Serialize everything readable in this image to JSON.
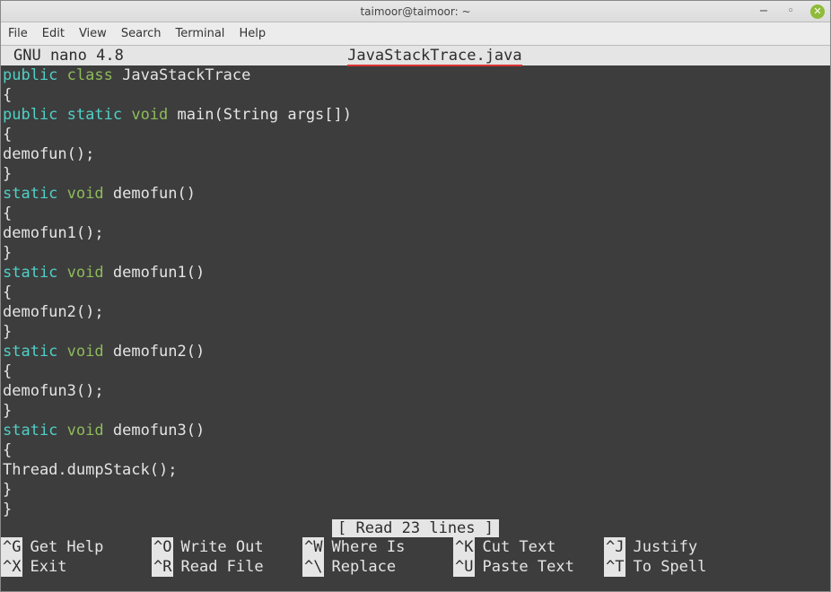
{
  "window": {
    "title": "taimoor@taimoor: ~"
  },
  "menu": {
    "items": [
      "File",
      "Edit",
      "View",
      "Search",
      "Terminal",
      "Help"
    ]
  },
  "nano": {
    "version": "GNU nano 4.8",
    "filename": "JavaStackTrace.java",
    "status": "[ Read 23 lines ]"
  },
  "code": [
    [
      {
        "c": "k1",
        "t": "public"
      },
      {
        "c": "fg",
        "t": " "
      },
      {
        "c": "k2",
        "t": "class"
      },
      {
        "c": "fg",
        "t": " JavaStackTrace"
      }
    ],
    [
      {
        "c": "fg",
        "t": "{"
      }
    ],
    [
      {
        "c": "k1",
        "t": "public"
      },
      {
        "c": "fg",
        "t": " "
      },
      {
        "c": "k1",
        "t": "static"
      },
      {
        "c": "fg",
        "t": " "
      },
      {
        "c": "k2",
        "t": "void"
      },
      {
        "c": "fg",
        "t": " main(String args[])"
      }
    ],
    [
      {
        "c": "fg",
        "t": "{"
      }
    ],
    [
      {
        "c": "fg",
        "t": "demofun();"
      }
    ],
    [
      {
        "c": "fg",
        "t": "}"
      }
    ],
    [
      {
        "c": "k1",
        "t": "static"
      },
      {
        "c": "fg",
        "t": " "
      },
      {
        "c": "k2",
        "t": "void"
      },
      {
        "c": "fg",
        "t": " demofun()"
      }
    ],
    [
      {
        "c": "fg",
        "t": "{"
      }
    ],
    [
      {
        "c": "fg",
        "t": "demofun1();"
      }
    ],
    [
      {
        "c": "fg",
        "t": "}"
      }
    ],
    [
      {
        "c": "k1",
        "t": "static"
      },
      {
        "c": "fg",
        "t": " "
      },
      {
        "c": "k2",
        "t": "void"
      },
      {
        "c": "fg",
        "t": " demofun1()"
      }
    ],
    [
      {
        "c": "fg",
        "t": "{"
      }
    ],
    [
      {
        "c": "fg",
        "t": "demofun2();"
      }
    ],
    [
      {
        "c": "fg",
        "t": "}"
      }
    ],
    [
      {
        "c": "k1",
        "t": "static"
      },
      {
        "c": "fg",
        "t": " "
      },
      {
        "c": "k2",
        "t": "void"
      },
      {
        "c": "fg",
        "t": " demofun2()"
      }
    ],
    [
      {
        "c": "fg",
        "t": "{"
      }
    ],
    [
      {
        "c": "fg",
        "t": "demofun3();"
      }
    ],
    [
      {
        "c": "fg",
        "t": "}"
      }
    ],
    [
      {
        "c": "k1",
        "t": "static"
      },
      {
        "c": "fg",
        "t": " "
      },
      {
        "c": "k2",
        "t": "void"
      },
      {
        "c": "fg",
        "t": " demofun3()"
      }
    ],
    [
      {
        "c": "fg",
        "t": "{"
      }
    ],
    [
      {
        "c": "fg",
        "t": "Thread.dumpStack();"
      }
    ],
    [
      {
        "c": "fg",
        "t": "}"
      }
    ],
    [
      {
        "c": "fg",
        "t": "}"
      }
    ]
  ],
  "shortcuts": [
    [
      {
        "key": "^G",
        "label": "Get Help"
      },
      {
        "key": "^O",
        "label": "Write Out"
      },
      {
        "key": "^W",
        "label": "Where Is"
      },
      {
        "key": "^K",
        "label": "Cut Text"
      },
      {
        "key": "^J",
        "label": "Justify"
      }
    ],
    [
      {
        "key": "^X",
        "label": "Exit"
      },
      {
        "key": "^R",
        "label": "Read File"
      },
      {
        "key": "^\\",
        "label": "Replace"
      },
      {
        "key": "^U",
        "label": "Paste Text"
      },
      {
        "key": "^T",
        "label": "To Spell"
      }
    ]
  ]
}
